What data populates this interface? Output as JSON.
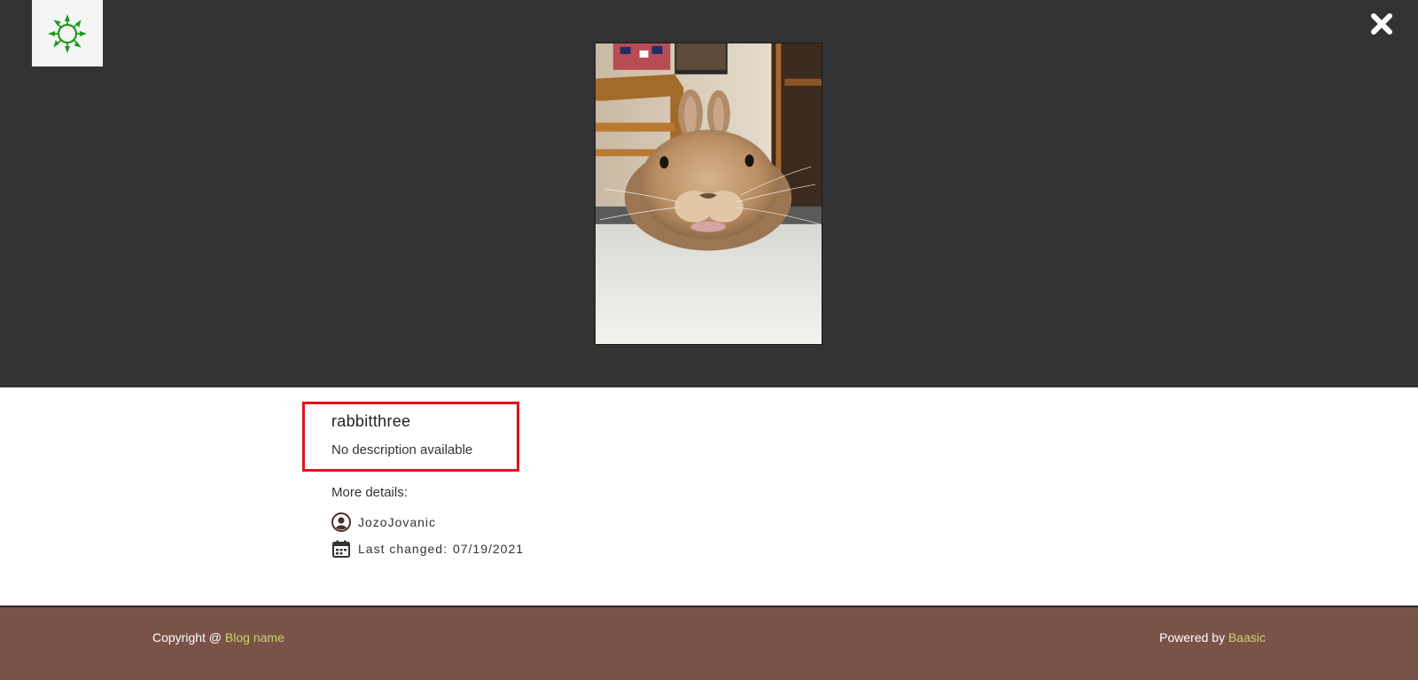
{
  "header": {
    "logo_icon": "sunburst-logo-icon",
    "logo_color": "#1e9a1e",
    "close_icon": "close-x-icon"
  },
  "image": {
    "subject": "rabbit photo",
    "title": "rabbitthree",
    "description": "No description available"
  },
  "details": {
    "heading": "More details:",
    "author": "JozoJovanic",
    "author_icon": "user-circle-icon",
    "date_label": "Last changed:",
    "date_value": "07/19/2021",
    "date_icon": "calendar-icon"
  },
  "footer": {
    "copyright_prefix": "Copyright @ ",
    "blog_name": "Blog name",
    "powered_prefix": "Powered by ",
    "powered_name": "Baasic",
    "background": "#7a5348",
    "accent": "#c9d36a"
  },
  "highlight_color": "#e0141e"
}
